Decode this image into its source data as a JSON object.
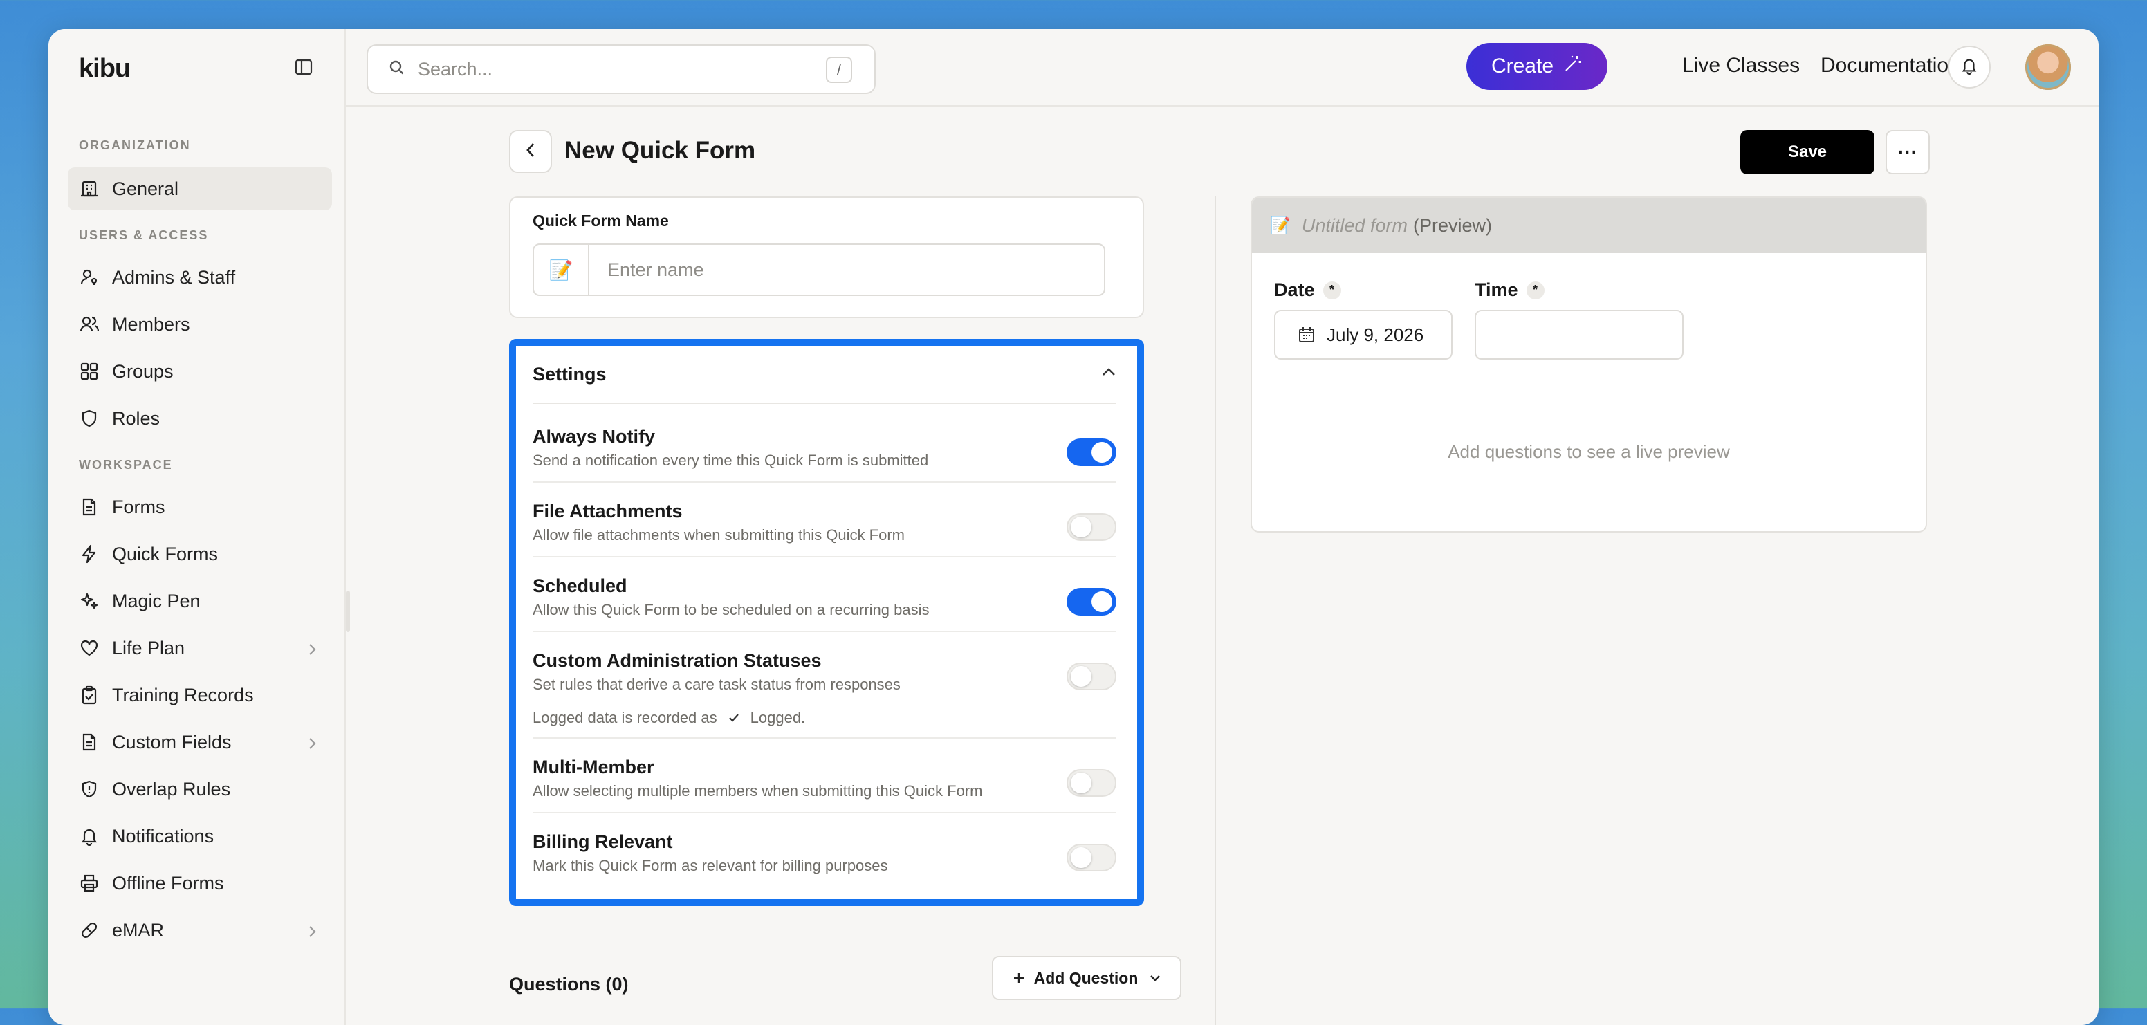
{
  "app": {
    "logo": "kibu",
    "search_placeholder": "Search...",
    "search_shortcut": "/",
    "header_links": [
      "Live Classes",
      "Documentation"
    ],
    "create_label": "Create"
  },
  "sidebar": {
    "sections": [
      {
        "label": "ORGANIZATION",
        "items": [
          {
            "label": "General",
            "icon": "building-icon",
            "active": true
          }
        ]
      },
      {
        "label": "USERS & ACCESS",
        "items": [
          {
            "label": "Admins & Staff",
            "icon": "user-key-icon"
          },
          {
            "label": "Members",
            "icon": "users-icon"
          },
          {
            "label": "Groups",
            "icon": "grid-icon"
          },
          {
            "label": "Roles",
            "icon": "shield-icon"
          }
        ]
      },
      {
        "label": "WORKSPACE",
        "items": [
          {
            "label": "Forms",
            "icon": "document-icon"
          },
          {
            "label": "Quick Forms",
            "icon": "lightning-icon"
          },
          {
            "label": "Magic Pen",
            "icon": "sparkles-icon"
          },
          {
            "label": "Life Plan",
            "icon": "heart-icon",
            "chevron": true
          },
          {
            "label": "Training Records",
            "icon": "clipboard-check-icon"
          },
          {
            "label": "Custom Fields",
            "icon": "document-icon",
            "chevron": true
          },
          {
            "label": "Overlap Rules",
            "icon": "shield-alert-icon"
          },
          {
            "label": "Notifications",
            "icon": "bell-icon"
          },
          {
            "label": "Offline Forms",
            "icon": "printer-icon"
          },
          {
            "label": "eMAR",
            "icon": "pill-icon",
            "chevron": true
          }
        ]
      }
    ]
  },
  "page": {
    "title": "New Quick Form",
    "save_label": "Save",
    "more_label": "···",
    "name_field": {
      "label": "Quick Form Name",
      "placeholder": "Enter name",
      "value": ""
    }
  },
  "settings": {
    "title": "Settings",
    "rows": [
      {
        "title": "Always Notify",
        "description": "Send a notification every time this Quick Form is submitted",
        "enabled": true
      },
      {
        "title": "File Attachments",
        "description": "Allow file attachments when submitting this Quick Form",
        "enabled": false
      },
      {
        "title": "Scheduled",
        "description": "Allow this Quick Form to be scheduled on a recurring basis",
        "enabled": true
      },
      {
        "title": "Custom Administration Statuses",
        "description": "Set rules that derive a care task status from responses",
        "enabled": false,
        "extra_prefix": "Logged data is recorded as",
        "extra_value": "Logged."
      },
      {
        "title": "Multi-Member",
        "description": "Allow selecting multiple members when submitting this Quick Form",
        "enabled": false
      },
      {
        "title": "Billing Relevant",
        "description": "Mark this Quick Form as relevant for billing purposes",
        "enabled": false
      }
    ]
  },
  "questions": {
    "label": "Questions (0)",
    "add_label": "Add Question"
  },
  "preview": {
    "form_title": "Untitled form",
    "preview_tag": "(Preview)",
    "date_label": "Date",
    "date_value": "July 9, 2026",
    "time_label": "Time",
    "required_mark": "*",
    "empty_hint": "Add questions to see a live preview"
  },
  "colors": {
    "accent": "#1573f0",
    "toggle_on": "#1566f0",
    "create_start": "#3b2fd6",
    "create_end": "#6a28c8"
  }
}
